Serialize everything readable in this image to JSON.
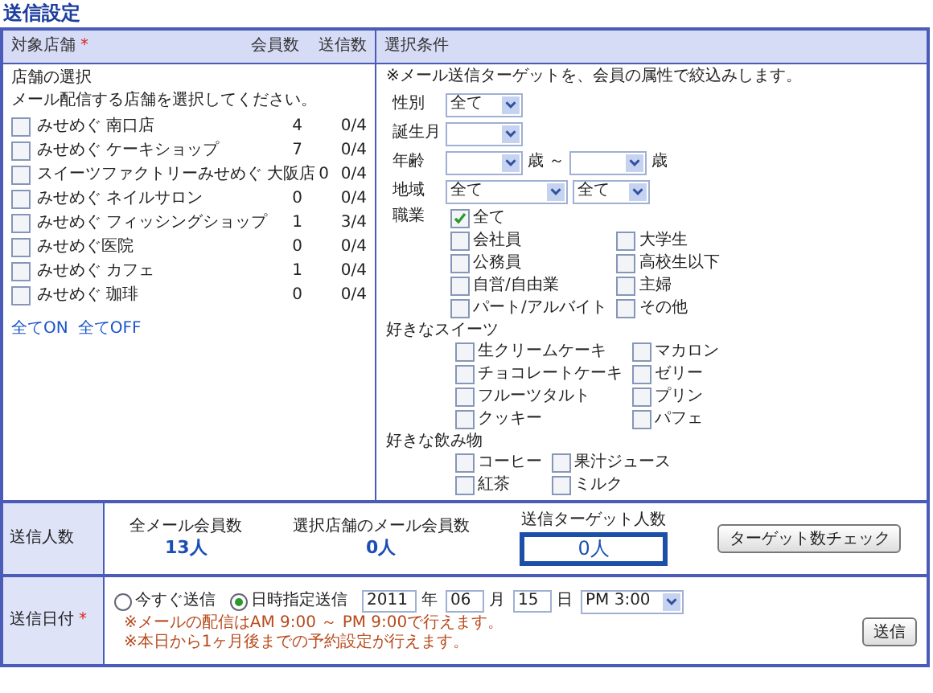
{
  "title": "送信設定",
  "stores_panel": {
    "header": "対象店舗",
    "required_mark": "*",
    "columns": [
      "会員数",
      "送信数"
    ],
    "heading": "店舗の選択",
    "instruction": "メール配信する店舗を選択してください。",
    "stores": [
      {
        "name": "みせめぐ 南口店",
        "members": "4",
        "sent": "0/4",
        "checked": false
      },
      {
        "name": "みせめぐ ケーキショップ",
        "members": "7",
        "sent": "0/4",
        "checked": false
      },
      {
        "name": "スイーツファクトリーみせめぐ 大阪店",
        "members": "0",
        "sent": "0/4",
        "checked": false
      },
      {
        "name": "みせめぐ ネイルサロン",
        "members": "0",
        "sent": "0/4",
        "checked": false
      },
      {
        "name": "みせめぐ フィッシングショップ",
        "members": "1",
        "sent": "3/4",
        "checked": false
      },
      {
        "name": "みせめぐ医院",
        "members": "0",
        "sent": "0/4",
        "checked": false
      },
      {
        "name": "みせめぐ カフェ",
        "members": "1",
        "sent": "0/4",
        "checked": false
      },
      {
        "name": "みせめぐ 珈琲",
        "members": "0",
        "sent": "0/4",
        "checked": false
      }
    ],
    "links": [
      "全てON",
      "全てOFF"
    ]
  },
  "conditions_panel": {
    "header": "選択条件",
    "note": "※メール送信ターゲットを、会員の属性で絞込みします。",
    "filters": [
      {
        "label": "性別",
        "parts": [
          {
            "kind": "select",
            "value": "全て"
          }
        ]
      },
      {
        "label": "誕生月",
        "parts": [
          {
            "kind": "select"
          }
        ]
      },
      {
        "label": "年齢",
        "parts": [
          {
            "kind": "select"
          },
          {
            "kind": "text",
            "text": "歳 ～"
          },
          {
            "kind": "select"
          },
          {
            "kind": "text",
            "text": "歳"
          }
        ]
      },
      {
        "label": "地域",
        "parts": [
          {
            "kind": "select",
            "value": "全て"
          },
          {
            "kind": "select",
            "value": "全て"
          }
        ]
      }
    ],
    "groups": [
      {
        "label": "職業",
        "all_option": {
          "label": "全て",
          "checked": true
        },
        "options": [
          {
            "label": "会社員",
            "checked": false
          },
          {
            "label": "大学生",
            "checked": false
          },
          {
            "label": "公務員",
            "checked": false
          },
          {
            "label": "高校生以下",
            "checked": false
          },
          {
            "label": "自営/自由業",
            "checked": false
          },
          {
            "label": "主婦",
            "checked": false
          },
          {
            "label": "パート/アルバイト",
            "checked": false
          },
          {
            "label": "その他",
            "checked": false
          }
        ]
      },
      {
        "label": "好きなスイーツ",
        "options": [
          {
            "label": "生クリームケーキ",
            "checked": false
          },
          {
            "label": "マカロン",
            "checked": false
          },
          {
            "label": "チョコレートケーキ",
            "checked": false
          },
          {
            "label": "ゼリー",
            "checked": false
          },
          {
            "label": "フルーツタルト",
            "checked": false
          },
          {
            "label": "プリン",
            "checked": false
          },
          {
            "label": "クッキー",
            "checked": false
          },
          {
            "label": "パフェ",
            "checked": false
          }
        ]
      },
      {
        "label": "好きな飲み物",
        "options": [
          {
            "label": "コーヒー",
            "checked": false
          },
          {
            "label": "果汁ジュース",
            "checked": false
          },
          {
            "label": "紅茶",
            "checked": false
          },
          {
            "label": "ミルク",
            "checked": false
          }
        ]
      }
    ]
  },
  "recipients": {
    "label": "送信人数",
    "stats": [
      {
        "label": "全メール会員数",
        "value": "13人"
      },
      {
        "label": "選択店舗のメール会員数",
        "value": "0人"
      }
    ],
    "target": {
      "label": "送信ターゲット人数",
      "value": "0人"
    },
    "check_button": "ターゲット数チェック"
  },
  "schedule": {
    "label": "送信日付",
    "required_mark": "*",
    "options": [
      {
        "label": "今すぐ送信",
        "selected": false
      },
      {
        "label": "日時指定送信",
        "selected": true
      }
    ],
    "date": [
      {
        "value": "2011",
        "unit": "年"
      },
      {
        "value": "06",
        "unit": "月"
      },
      {
        "value": "15",
        "unit": "日"
      }
    ],
    "time": "PM 3:00",
    "notes": [
      "※メールの配信はAM 9:00 ～ PM 9:00で行えます。",
      "※本日から1ヶ月後までの予約設定が行えます。"
    ],
    "send_button": "送信"
  }
}
